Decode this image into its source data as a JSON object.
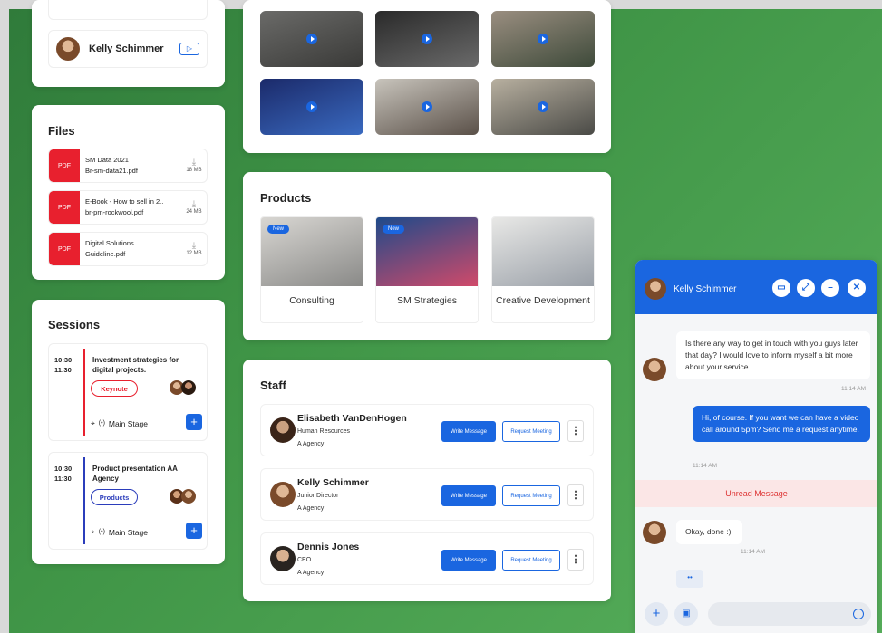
{
  "top_card": {
    "name": "Kelly Schimmer"
  },
  "files": {
    "title": "Files",
    "items": [
      {
        "icon": "PDF",
        "name": "SM Data 2021",
        "file": "Br-sm-data21.pdf",
        "size": "18 MB"
      },
      {
        "icon": "PDF",
        "name": "E-Book - How to sell in 2..",
        "file": "br-pm-rockwool.pdf",
        "size": "24 MB"
      },
      {
        "icon": "PDF",
        "name": "Digital Solutions",
        "file": "Guideline.pdf",
        "size": "12 MB"
      }
    ]
  },
  "sessions": {
    "title": "Sessions",
    "items": [
      {
        "start": "10:30",
        "end": "11:30",
        "title": "Investment strategies for digital projects.",
        "tag": "Keynote",
        "tag_color": "#e8202e",
        "stage": "Main Stage",
        "bar_color": "#e8202e"
      },
      {
        "start": "10:30",
        "end": "11:30",
        "title": "Product presentation AA Agency",
        "tag": "Products",
        "tag_color": "#2b3dbb",
        "stage": "Main Stage",
        "bar_color": "#2b3dbb"
      }
    ]
  },
  "products": {
    "title": "Products",
    "items": [
      {
        "label": "Consulting",
        "badge": "New"
      },
      {
        "label": "SM Strategies",
        "badge": "New"
      },
      {
        "label": "Creative Development",
        "badge": ""
      }
    ]
  },
  "staff": {
    "title": "Staff",
    "write_label": "Write Message",
    "request_label": "Request Meeting",
    "members": [
      {
        "name": "Elisabeth VanDenHogen",
        "role": "Human Resources",
        "agency": "A Agency"
      },
      {
        "name": "Kelly Schimmer",
        "role": "Junior Director",
        "agency": "A Agency"
      },
      {
        "name": "Dennis Jones",
        "role": "CEO",
        "agency": "A Agency"
      }
    ]
  },
  "chat": {
    "name": "Kelly Schimmer",
    "messages": [
      {
        "from": "them",
        "text": "Is there any way to get in touch with you guys later that day? I would love to inform myself a bit more about your service.",
        "time": "11:14 AM"
      },
      {
        "from": "me",
        "text": "Hi, of course. If you want we can have a video call around 5pm? Send me a request anytime.",
        "time": "11:14 AM"
      },
      {
        "from": "them",
        "text": "Okay, done :)!",
        "time": "11:14 AM"
      }
    ],
    "unread_label": "Unread Message",
    "typing": "••",
    "input_placeholder": ""
  },
  "colors": {
    "accent": "#1a66e0",
    "pdf": "#e8202e",
    "background": "#3f9446"
  }
}
